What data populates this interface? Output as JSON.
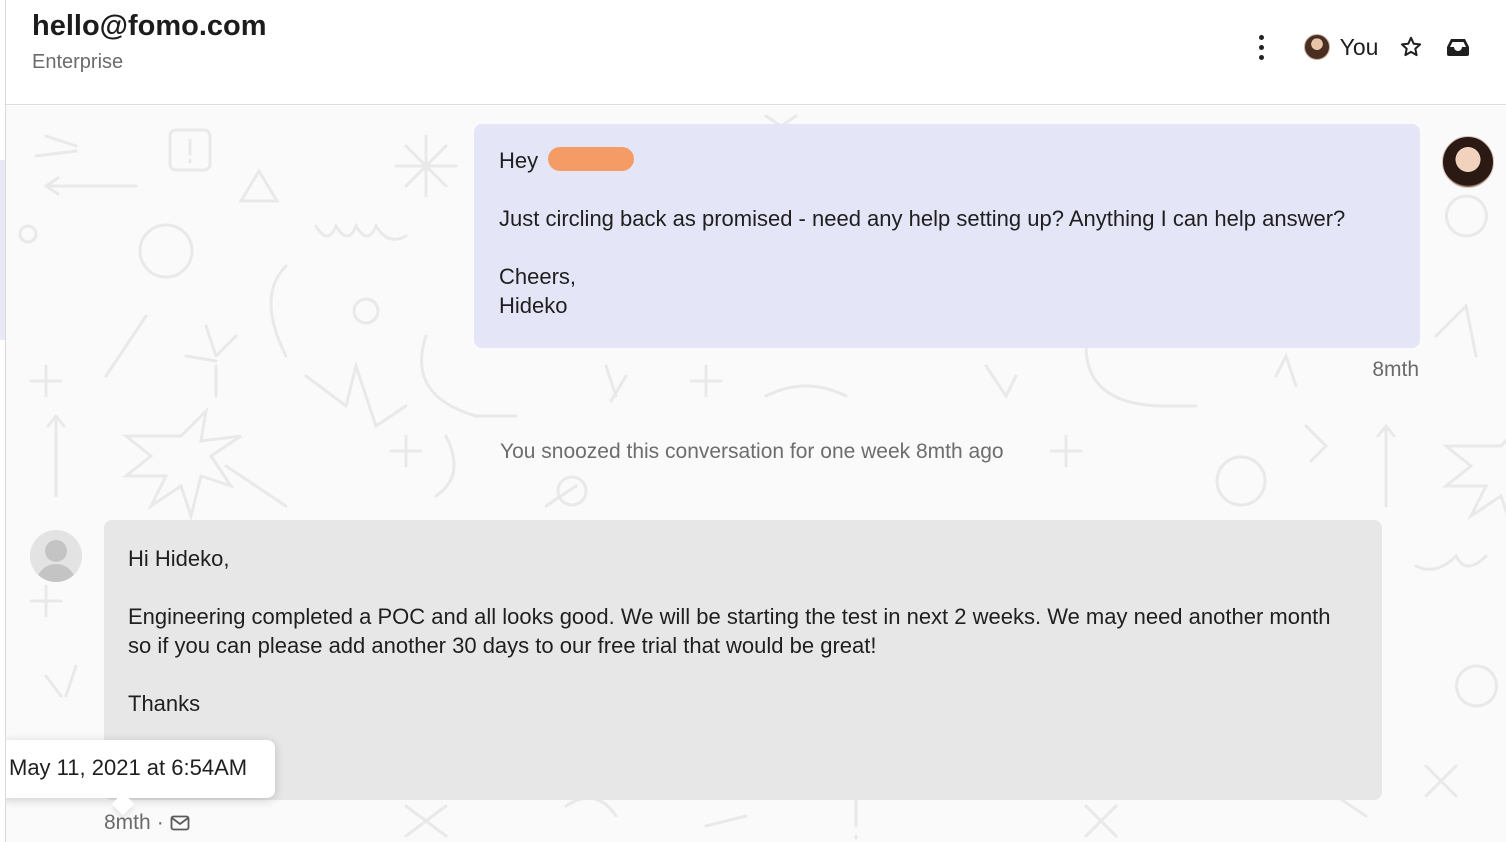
{
  "header": {
    "contact_email": "hello@fomo.com",
    "plan": "Enterprise",
    "assignee_label": "You",
    "icons": [
      "more-vertical-icon",
      "star-icon",
      "inbox-icon"
    ]
  },
  "thread": {
    "outgoing": {
      "greeting": "Hey",
      "body": "Just circling back as promised - need any help setting up? Anything I can help answer?",
      "signoff": "Cheers,",
      "signature": "Hideko",
      "time": "8mth"
    },
    "system_note": "You snoozed this conversation for one week 8mth ago",
    "incoming": {
      "greeting": "Hi Hideko,",
      "body": "Engineering completed a POC and all looks good. We will be starting the test in next 2 weeks. We may need another month so if you can please add another 30 days to our free trial that would be great!",
      "signoff": "Thanks",
      "time": "8mth",
      "tooltip": "May 11, 2021 at 6:54AM"
    }
  },
  "colors": {
    "outgoing_bubble": "#e4e6f8",
    "incoming_bubble": "#e7e7e7",
    "redaction": "#f49b66"
  }
}
